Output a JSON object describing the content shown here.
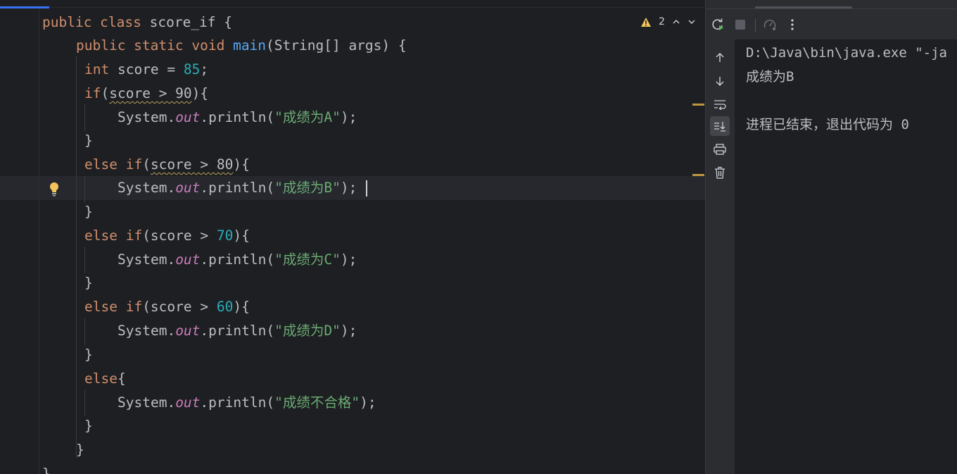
{
  "code": {
    "line1": {
      "kw": "public class",
      "name": " score_if {"
    },
    "line2": {
      "kw": "public static void",
      "sp": " ",
      "fn": "main",
      "rest": "(String[] args) {"
    },
    "line3": {
      "kw": "int",
      "rest": " score = ",
      "num": "85",
      "end": ";"
    },
    "line4": {
      "kw": "if",
      "open": "(",
      "cond": "score > 90",
      "close": "){"
    },
    "line5": {
      "pre": "System.",
      "fld": "out",
      "mid": ".println(",
      "str": "\"成绩为A\"",
      "end": ");"
    },
    "line6": "}",
    "line7": {
      "kw": "else if",
      "open": "(",
      "cond": "score > 80",
      "close": "){"
    },
    "line8": {
      "pre": "System.",
      "fld": "out",
      "mid": ".println(",
      "str": "\"成绩为B\"",
      "end": ");"
    },
    "line9": "}",
    "line10": {
      "kw": "else if",
      "open": "(score > ",
      "num": "70",
      "close": "){"
    },
    "line11": {
      "pre": "System.",
      "fld": "out",
      "mid": ".println(",
      "str": "\"成绩为C\"",
      "end": ");"
    },
    "line12": "}",
    "line13": {
      "kw": "else if",
      "open": "(score > ",
      "num": "60",
      "close": "){"
    },
    "line14": {
      "pre": "System.",
      "fld": "out",
      "mid": ".println(",
      "str": "\"成绩为D\"",
      "end": ");"
    },
    "line15": "}",
    "line16": {
      "kw": "else",
      "close": "{"
    },
    "line17": {
      "pre": "System.",
      "fld": "out",
      "mid": ".println(",
      "str": "\"成绩不合格\"",
      "end": ");"
    },
    "line18": "}",
    "line19": "}",
    "line20": "}"
  },
  "inspection": {
    "warning_count": "2",
    "icons": [
      "warning-icon",
      "chevron-up-icon",
      "chevron-down-icon"
    ]
  },
  "run_toolbar": {
    "icons": [
      "rerun-icon",
      "stop-icon",
      "profiler-icon",
      "more-vertical-icon"
    ]
  },
  "side_toolbar": {
    "icons": [
      "arrow-up-icon",
      "arrow-down-icon",
      "soft-wrap-icon",
      "scroll-to-end-icon",
      "print-icon",
      "trash-icon"
    ]
  },
  "console": {
    "command": "D:\\Java\\bin\\java.exe \"-ja",
    "output": "成绩为B",
    "exit_message": "进程已结束，退出代码为 0"
  },
  "colors": {
    "keyword": "#cf8e6d",
    "function": "#56a8f5",
    "number": "#2aacb8",
    "string": "#6aab73",
    "field": "#c77dbb",
    "warning": "#c0953f",
    "accent": "#3574f0"
  }
}
